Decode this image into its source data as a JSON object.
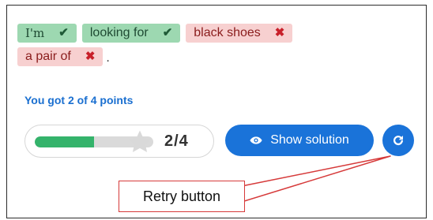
{
  "answers": {
    "row1": [
      {
        "word": "I'm",
        "status": "correct",
        "mark": "✔"
      },
      {
        "word": "looking for",
        "status": "correct",
        "mark": "✔"
      },
      {
        "word": "black shoes",
        "status": "wrong",
        "mark": "✖"
      }
    ],
    "row2": [
      {
        "word": "a pair of",
        "status": "wrong",
        "mark": "✖"
      }
    ],
    "terminal_punctuation": "."
  },
  "score_text": "You got 2 of 4 points",
  "progress": {
    "score_label": "2/4",
    "fraction": 0.5
  },
  "buttons": {
    "show_solution_label": "Show solution",
    "show_solution_icon": "eye-icon",
    "retry_icon": "retry-icon"
  },
  "callout": {
    "label": "Retry button"
  },
  "colors": {
    "correct_bg": "#9dd8b1",
    "wrong_bg": "#f7d0d0",
    "accent_blue": "#1a73d9",
    "progress_fill": "#34b36b",
    "callout_border": "#d63a3a"
  }
}
